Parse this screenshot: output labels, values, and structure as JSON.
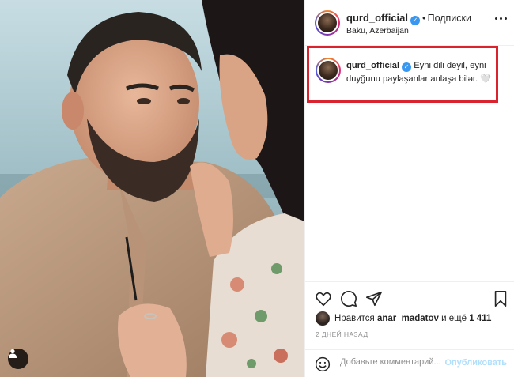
{
  "post": {
    "username": "qurd_official",
    "follow_label": "Подписки",
    "location": "Baku, Azerbaijan",
    "caption": "Eyni dili deyil, eyni duyğunu paylaşanlar anlaşa bilər. 🤍"
  },
  "likes": {
    "prefix": "Нравится",
    "user": "anar_madatov",
    "middle": "и ещё",
    "count": "1 411"
  },
  "time_ago": "2 ДНЕЙ НАЗАД",
  "comment": {
    "placeholder": "Добавьте комментарий...",
    "post_label": "Опубликовать"
  },
  "icons": {
    "verified": "verified-badge-icon",
    "more": "more-options-icon",
    "like": "heart-icon",
    "comment": "comment-bubble-icon",
    "share": "paper-plane-icon",
    "save": "bookmark-icon",
    "emoji": "emoji-smile-icon",
    "user_tag": "user-tag-icon"
  },
  "colors": {
    "highlight_border": "#d9232e",
    "verified": "#3897f0",
    "post_button": "#b2dffc"
  }
}
